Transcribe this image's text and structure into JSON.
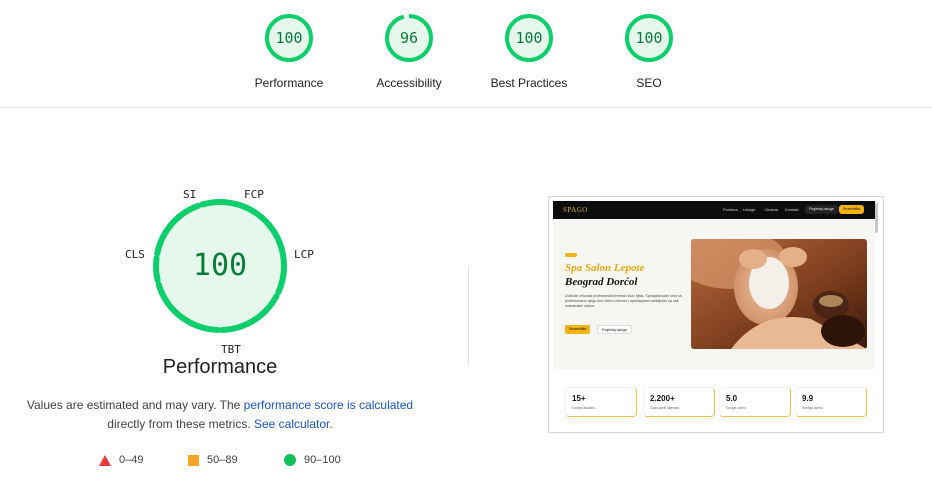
{
  "categories": [
    {
      "label": "Performance",
      "score": "100",
      "fraction": 1.0
    },
    {
      "label": "Accessibility",
      "score": "96",
      "fraction": 0.96
    },
    {
      "label": "Best Practices",
      "score": "100",
      "fraction": 1.0
    },
    {
      "label": "SEO",
      "score": "100",
      "fraction": 1.0
    }
  ],
  "performance": {
    "score": "100",
    "title": "Performance",
    "metrics": [
      "SI",
      "FCP",
      "LCP",
      "TBT",
      "CLS"
    ],
    "note_text_1": "Values are estimated and may vary. The ",
    "note_link_1": "performance score is calculated",
    "note_text_2": "directly from these metrics. ",
    "note_link_2": "See calculator.",
    "legend": [
      {
        "icon": "triangle-icon",
        "range": "0–49",
        "color": "#eb3a3a"
      },
      {
        "icon": "square-icon",
        "range": "50–89",
        "color": "#f4a524"
      },
      {
        "icon": "circle-icon",
        "range": "90–100",
        "color": "#13c15a"
      }
    ]
  },
  "colors": {
    "pass": "#0cce6b",
    "pass_fill": "#e6f7ec",
    "pass_text": "#0a7d3a",
    "accent": "#f2b316"
  },
  "screenshot": {
    "logo": "SPAGO",
    "nav_links": [
      "Početna",
      "Usluge",
      "Onama",
      "Kontakt"
    ],
    "nav_btn_1": "Pogledaj usluge",
    "nav_btn_2": "Rezervišite",
    "badge": "SPA",
    "hero_title_1": "Spa Salon Lepote",
    "hero_title_2": "Beograd Dorćol",
    "hero_text": "Doživite vrhunski profesionalni tretman lica i tijela. Specijalizovani smo za profesionalnu njegu lica i tela u mirnom i opuštajućem ambijentu za vaš maksimalni odmor.",
    "hero_btn_1": "Rezervišite",
    "hero_btn_2": "Pogledaj usluge",
    "stats": [
      {
        "value": "15+",
        "label": "Godina iskustva"
      },
      {
        "value": "2.200+",
        "label": "Zadovoljnih klijenata"
      },
      {
        "value": "5.0",
        "label": "Google ocena"
      },
      {
        "value": "9.9",
        "label": "Srednja ocena"
      }
    ]
  }
}
